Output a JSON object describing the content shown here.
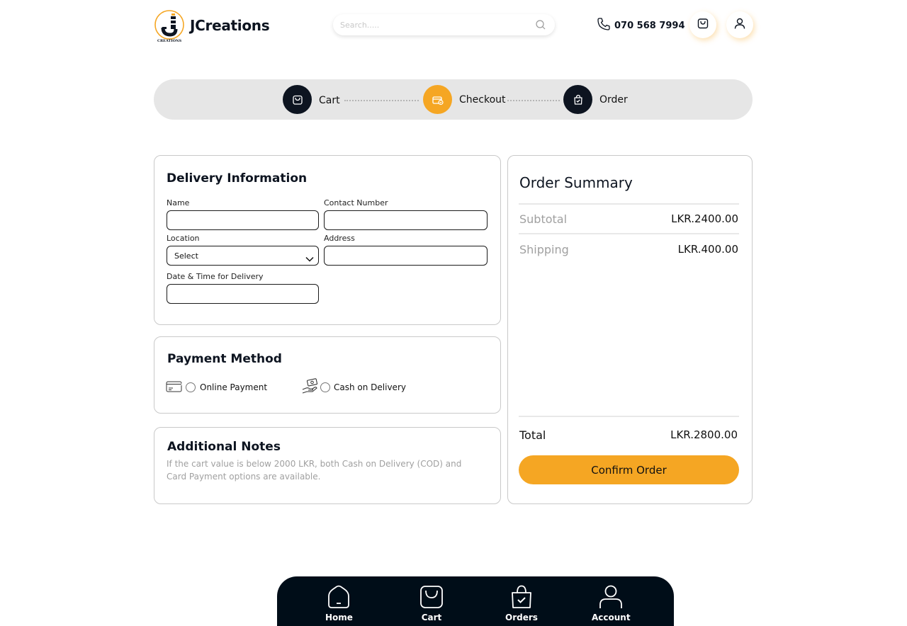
{
  "header": {
    "brand": "JCreations",
    "logo_text": "CREATIONS",
    "search_placeholder": "Search.....",
    "phone": "070 568 7994"
  },
  "stepper": {
    "steps": [
      {
        "label": "Cart",
        "state": "done"
      },
      {
        "label": "Checkout",
        "state": "active"
      },
      {
        "label": "Order",
        "state": "pending"
      }
    ]
  },
  "delivery": {
    "title": "Delivery Information",
    "name_label": "Name",
    "name_value": "",
    "contact_label": "Contact Number",
    "contact_value": "",
    "location_label": "Location",
    "location_selected": "Select",
    "address_label": "Address",
    "address_value": "",
    "datetime_label": "Date & Time for Delivery",
    "datetime_value": ""
  },
  "payment": {
    "title": "Payment Method",
    "options": [
      {
        "label": "Online Payment",
        "icon": "credit-card-icon",
        "selected": false
      },
      {
        "label": "Cash on Delivery",
        "icon": "cash-hand-icon",
        "selected": false
      }
    ]
  },
  "notes": {
    "title": "Additional Notes",
    "line1": "If the cart value is below 2000 LKR, both Cash on Delivery (COD) and",
    "line2": "Card Payment options are available."
  },
  "summary": {
    "title": "Order Summary",
    "subtotal_label": "Subtotal",
    "subtotal_value": "LKR.2400.00",
    "shipping_label": "Shipping",
    "shipping_value": "LKR.400.00",
    "total_label": "Total",
    "total_value": "LKR.2800.00",
    "confirm_label": "Confirm Order"
  },
  "bottom_nav": {
    "items": [
      {
        "label": "Home",
        "icon": "home-icon"
      },
      {
        "label": "Cart",
        "icon": "bag-icon"
      },
      {
        "label": "Orders",
        "icon": "orders-bag-icon"
      },
      {
        "label": "Account",
        "icon": "user-icon"
      }
    ]
  },
  "colors": {
    "accent": "#f5a623",
    "dark": "#0d1420",
    "nav_bg": "#000d18",
    "stepper_bg": "#e6e6e6"
  }
}
